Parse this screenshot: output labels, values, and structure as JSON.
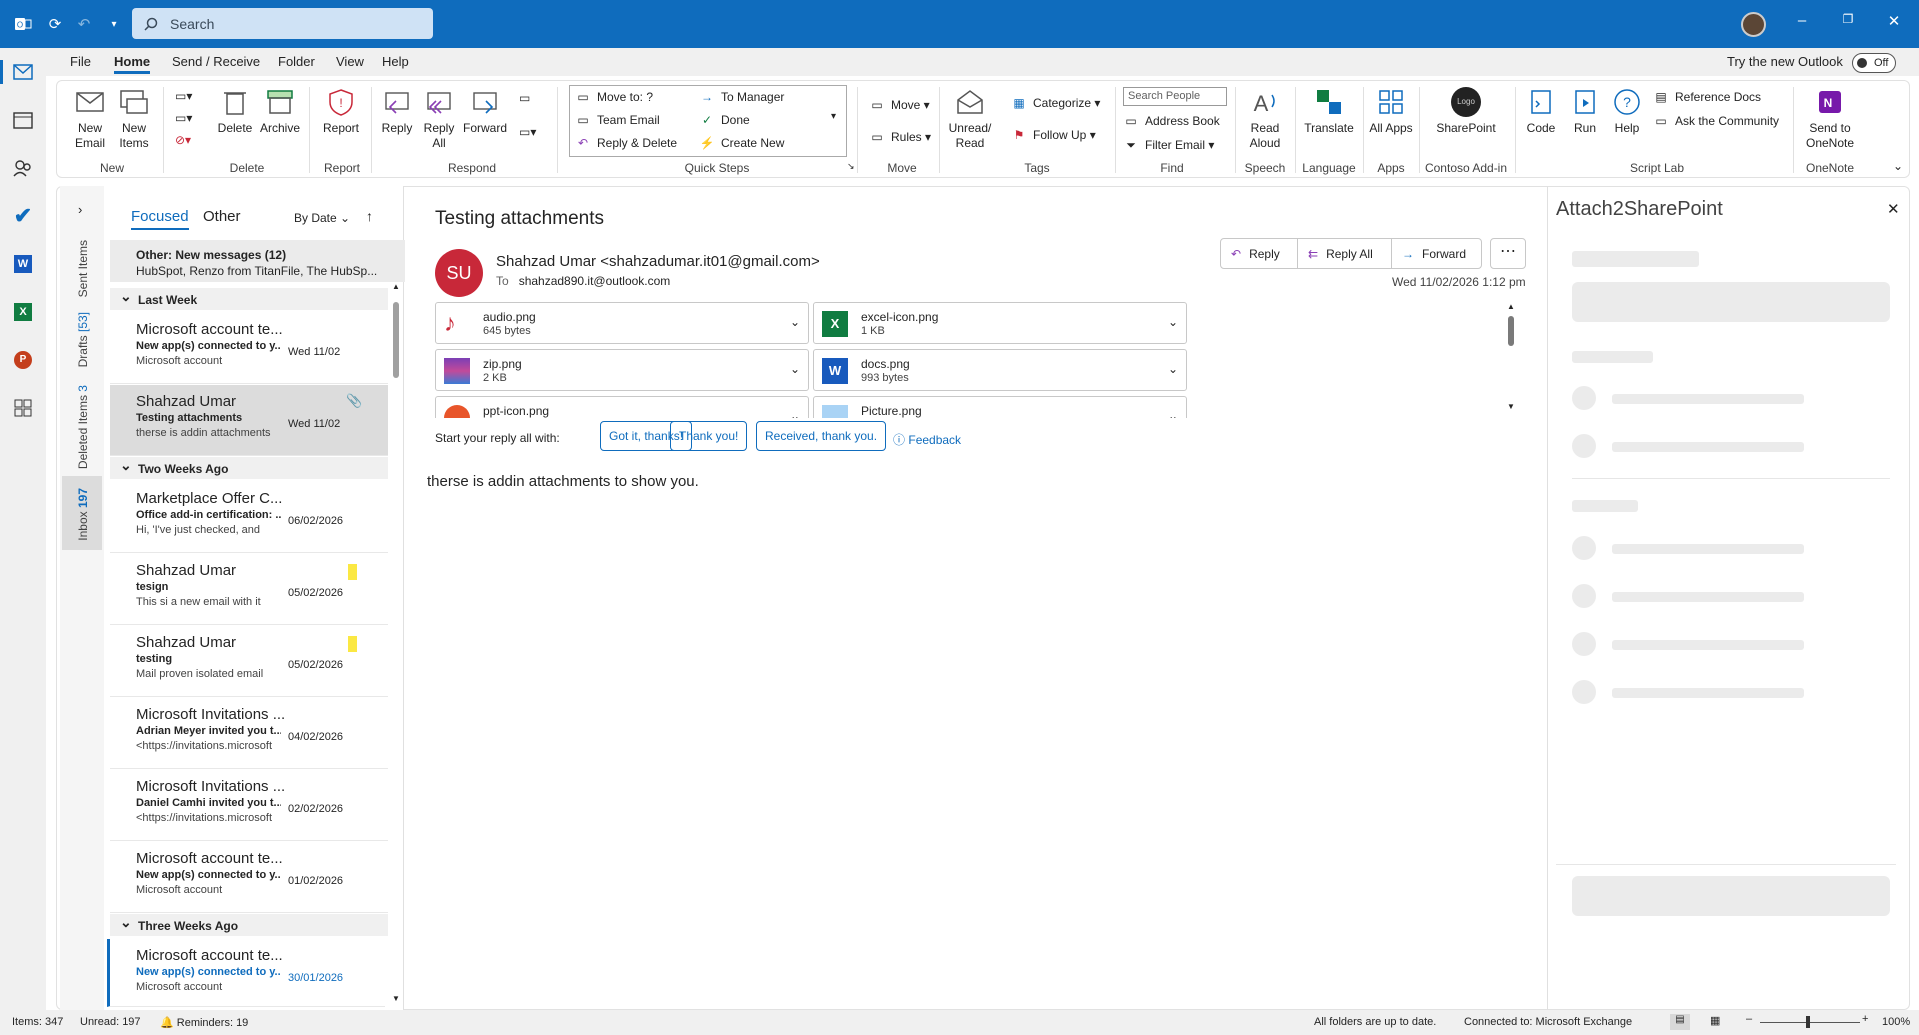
{
  "titlebar": {
    "search_placeholder": "Search"
  },
  "menu": [
    "File",
    "Home",
    "Send / Receive",
    "Folder",
    "View",
    "Help"
  ],
  "try_new": "Try the new Outlook",
  "toggle_state": "Off",
  "ribbon": {
    "new_email": "New Email",
    "new_items": "New Items",
    "delete": "Delete",
    "archive": "Archive",
    "report": "Report",
    "reply": "Reply",
    "reply_all": "Reply All",
    "forward": "Forward",
    "qs_move_to": "Move to: ?",
    "qs_team_email": "Team Email",
    "qs_reply_delete": "Reply & Delete",
    "qs_to_manager": "To Manager",
    "qs_done": "Done",
    "qs_create_new": "Create New",
    "move": "Move",
    "rules": "Rules",
    "unread_read": "Unread/ Read",
    "categorize": "Categorize",
    "follow_up": "Follow Up",
    "search_people": "Search People",
    "address_book": "Address Book",
    "filter_email": "Filter Email",
    "read_aloud": "Read Aloud",
    "translate": "Translate",
    "all_apps": "All Apps",
    "sharepoint": "SharePoint",
    "logo": "Logo",
    "code": "Code",
    "run": "Run",
    "help": "Help",
    "reference_docs": "Reference Docs",
    "ask_community": "Ask the Community",
    "send_onenote": "Send to OneNote",
    "groups": {
      "new": "New",
      "delete": "Delete",
      "report": "Report",
      "respond": "Respond",
      "quick_steps": "Quick Steps",
      "move": "Move",
      "tags": "Tags",
      "find": "Find",
      "speech": "Speech",
      "language": "Language",
      "apps": "Apps",
      "contoso": "Contoso Add-in",
      "script_lab": "Script Lab",
      "onenote": "OneNote"
    }
  },
  "folders": {
    "sent": "Sent Items",
    "drafts": "Drafts",
    "drafts_count": "[53]",
    "deleted": "Deleted Items",
    "deleted_count": "3",
    "inbox": "Inbox",
    "inbox_count": "197"
  },
  "list": {
    "tab_focused": "Focused",
    "tab_other": "Other",
    "sort": "By Date",
    "other_title": "Other: New messages (12)",
    "other_preview": "HubSpot, Renzo from TitanFile, The HubSp...",
    "groups": [
      "Last Week",
      "Two Weeks Ago",
      "Three Weeks Ago"
    ],
    "items": [
      {
        "from": "Microsoft account te...",
        "subject": "New app(s) connected to y...",
        "preview": "Microsoft account",
        "date": "Wed 11/02"
      },
      {
        "from": "Shahzad Umar",
        "subject": "Testing attachments",
        "preview": "therse is addin attachments",
        "date": "Wed 11/02"
      },
      {
        "from": "Marketplace Offer C...",
        "subject": "Office add-in certification: ...",
        "preview": "Hi,  'I've just checked, and",
        "date": "06/02/2026"
      },
      {
        "from": "Shahzad Umar",
        "subject": "tesign",
        "preview": "This si a new email with it",
        "date": "05/02/2026"
      },
      {
        "from": "Shahzad Umar",
        "subject": "testing",
        "preview": "Mail proven isolated email",
        "date": "05/02/2026"
      },
      {
        "from": "Microsoft Invitations ...",
        "subject": "Adrian Meyer invited you t...",
        "preview": "<https://invitations.microsoft",
        "date": "04/02/2026"
      },
      {
        "from": "Microsoft Invitations ...",
        "subject": "Daniel  Camhi invited you t...",
        "preview": "<https://invitations.microsoft",
        "date": "02/02/2026"
      },
      {
        "from": "Microsoft account te...",
        "subject": "New app(s) connected to y...",
        "preview": "Microsoft account",
        "date": "01/02/2026"
      },
      {
        "from": "Microsoft account te...",
        "subject": "New app(s) connected to y...",
        "preview": "Microsoft account",
        "date": "30/01/2026"
      }
    ]
  },
  "reading": {
    "title": "Testing attachments",
    "initials": "SU",
    "from": "Shahzad Umar <shahzadumar.it01@gmail.com>",
    "to_label": "To",
    "to": "shahzad890.it@outlook.com",
    "reply": "Reply",
    "reply_all": "Reply All",
    "forward": "Forward",
    "date": "Wed 11/02/2026 1:12 pm",
    "attachments": [
      {
        "name": "audio.png",
        "size": "645 bytes"
      },
      {
        "name": "excel-icon.png",
        "size": "1 KB"
      },
      {
        "name": "zip.png",
        "size": "2 KB"
      },
      {
        "name": "docs.png",
        "size": "993 bytes"
      },
      {
        "name": "ppt-icon.png",
        "size": ""
      },
      {
        "name": "Picture.png",
        "size": ""
      }
    ],
    "quick_label": "Start your reply all with:",
    "quick": [
      "Got it, thanks!",
      "Thank you!",
      "Received, thank you."
    ],
    "feedback": "Feedback",
    "body": "therse is addin attachments to show you."
  },
  "addin": {
    "title": "Attach2SharePoint"
  },
  "status": {
    "items": "Items: 347",
    "unread": "Unread: 197",
    "reminders": "Reminders: 19",
    "sync": "All folders are up to date.",
    "connected": "Connected to: Microsoft Exchange",
    "zoom": "100%"
  }
}
